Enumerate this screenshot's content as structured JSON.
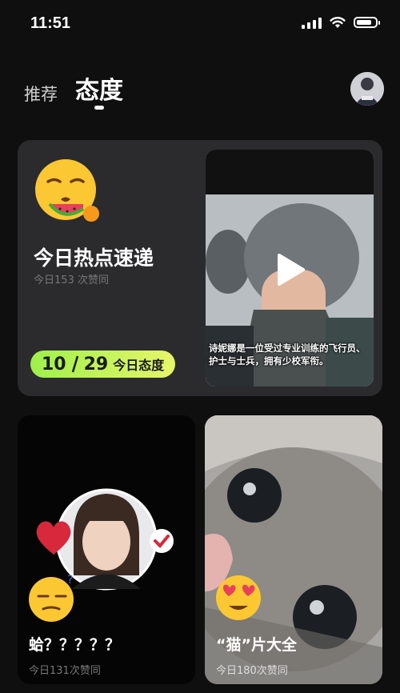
{
  "status": {
    "time": "11:51"
  },
  "tabs": [
    {
      "label": "推荐",
      "active": false
    },
    {
      "label": "态度",
      "active": true
    }
  ],
  "featured": {
    "title": "今日热点速递",
    "subtitle": "今日153 次赞同",
    "date_month": "10",
    "date_day": "29",
    "date_label": "今日态度",
    "video_caption": "诗妮娜是一位受过专业训练的飞行员、护士与士兵，拥有少校军衔。"
  },
  "cards": [
    {
      "title": "蛤？？？？？",
      "subtitle": "今日131次赞同"
    },
    {
      "title": "“猫”片大全",
      "subtitle": "今日180次赞同"
    }
  ],
  "colors": {
    "accent_green": "#9ef04a",
    "accent_yellow": "#e7f66a",
    "card_bg": "#2b2b2e",
    "page_bg": "#0f0f10"
  }
}
